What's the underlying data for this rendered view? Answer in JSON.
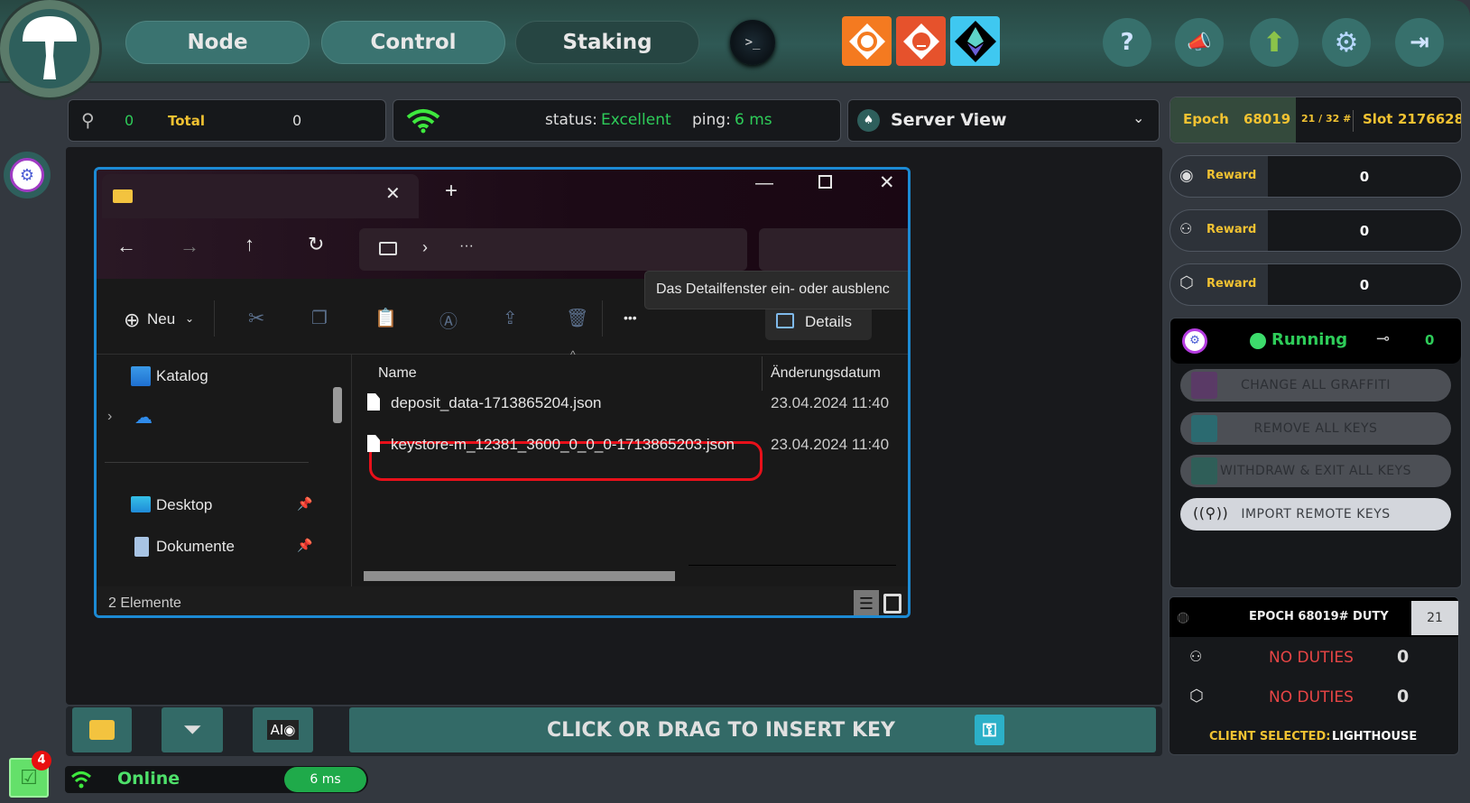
{
  "header": {
    "nav": [
      {
        "label": "Node"
      },
      {
        "label": "Control"
      },
      {
        "label": "Staking",
        "active": true
      }
    ],
    "terminal_icon": ">_",
    "plugins": [
      {
        "name": "grafana-icon",
        "color": "#f47a20"
      },
      {
        "name": "prometheus-icon",
        "color": "#e6522c"
      },
      {
        "name": "ethereum-icon",
        "color": "#3fc8f0"
      }
    ],
    "buttons": [
      {
        "name": "help-icon",
        "glyph": "?"
      },
      {
        "name": "announcement-icon",
        "glyph": "📣"
      },
      {
        "name": "update-icon",
        "glyph": "⬆"
      },
      {
        "name": "settings-icon",
        "glyph": "⚙"
      },
      {
        "name": "logout-icon",
        "glyph": "⇥"
      }
    ]
  },
  "keys_bar": {
    "count": "0",
    "total_label": "Total",
    "total_value": "0"
  },
  "status_bar": {
    "status_label": "status:",
    "status_value": "Excellent",
    "ping_label": "ping:",
    "ping_value": "6 ms"
  },
  "server_view": {
    "label": "Server View"
  },
  "epoch": {
    "epoch_label": "Epoch",
    "epoch_value": "68019",
    "slot_progress": "21 / 32 #",
    "slot_label": "Slot",
    "slot_value": "2176628"
  },
  "rewards": [
    {
      "icon": "eye-icon",
      "label": "Reward",
      "value": "0"
    },
    {
      "icon": "committee-icon",
      "label": "Reward",
      "value": "0"
    },
    {
      "icon": "cube-icon",
      "label": "Reward",
      "value": "0"
    }
  ],
  "validator": {
    "status": "Running",
    "key_count": "0",
    "buttons": [
      {
        "label": "CHANGE ALL GRAFFITI",
        "enabled": false
      },
      {
        "label": "REMOVE ALL KEYS",
        "enabled": false
      },
      {
        "label": "WITHDRAW & EXIT ALL KEYS",
        "enabled": false
      },
      {
        "label": "IMPORT REMOTE KEYS",
        "enabled": true
      }
    ]
  },
  "duty": {
    "title": "EPOCH 68019# DUTY",
    "slot": "21",
    "rows": [
      {
        "icon": "committee-icon",
        "label": "NO DUTIES",
        "value": "0"
      },
      {
        "icon": "cube-icon",
        "label": "NO DUTIES",
        "value": "0"
      }
    ],
    "client_label": "CLIENT SELECTED:",
    "client_value": "LIGHTHOUSE"
  },
  "explorer": {
    "new_label": "Neu",
    "more": "•••",
    "details_label": "Details",
    "tooltip": "Das Detailfenster ein- oder ausblenc",
    "breadcrumb_more": "···",
    "nav_items": [
      {
        "label": "Katalog"
      },
      {
        "label": ""
      },
      {
        "label": "Desktop"
      },
      {
        "label": "Dokumente"
      }
    ],
    "columns": {
      "name": "Name",
      "date": "Änderungsdatum"
    },
    "files": [
      {
        "name": "deposit_data-1713865204.json",
        "date": "23.04.2024 11:40"
      },
      {
        "name": "keystore-m_12381_3600_0_0_0-1713865203.json",
        "date": "23.04.2024 11:40",
        "highlighted": true
      }
    ],
    "status": "2 Elemente"
  },
  "bottom_toolbar": {
    "insert_label": "CLICK OR DRAG TO INSERT KEY"
  },
  "connection": {
    "label": "Online",
    "ping": "6 ms"
  },
  "notifications": {
    "count": "4"
  }
}
